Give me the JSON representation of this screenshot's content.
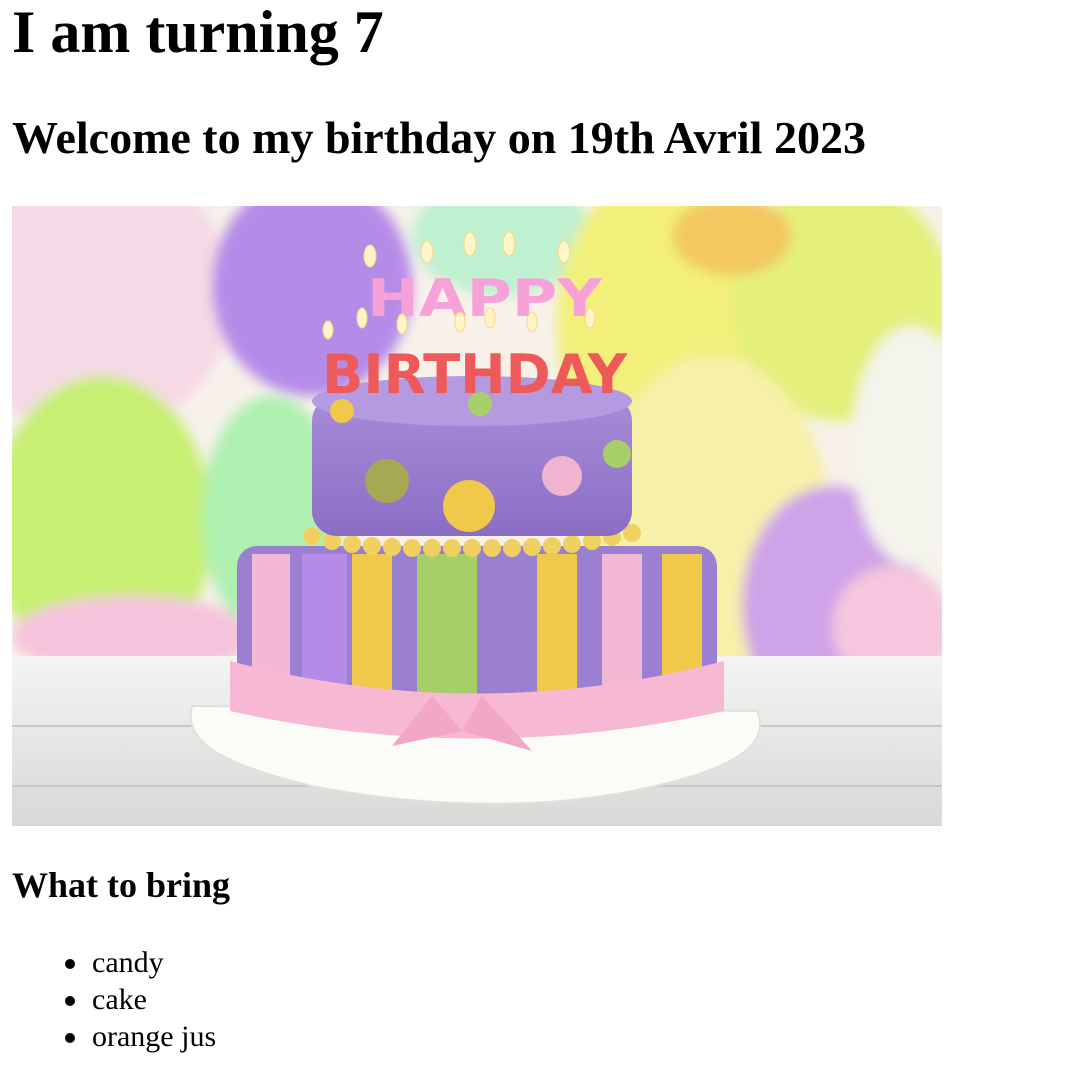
{
  "page": {
    "title": "I am turning 7",
    "subtitle": "Welcome to my birthday on 19th Avril 2023",
    "section_heading": "What to bring",
    "items": [
      "candy",
      "cake",
      "orange jus"
    ]
  },
  "image": {
    "subject": "two-tier birthday cake",
    "candle_text_top": "HAPPY",
    "candle_text_bottom": "BIRTHDAY",
    "colors": {
      "cake_top": "#9b7fd1",
      "cake_stripe_yellow": "#f0c84a",
      "cake_stripe_green": "#a6cf6a",
      "cake_stripe_pink": "#f3b9d4",
      "ribbon": "#f6b8d2",
      "balloon_yellow": "#eef27a",
      "balloon_purple": "#b58be8",
      "balloon_green": "#aef07a"
    }
  }
}
